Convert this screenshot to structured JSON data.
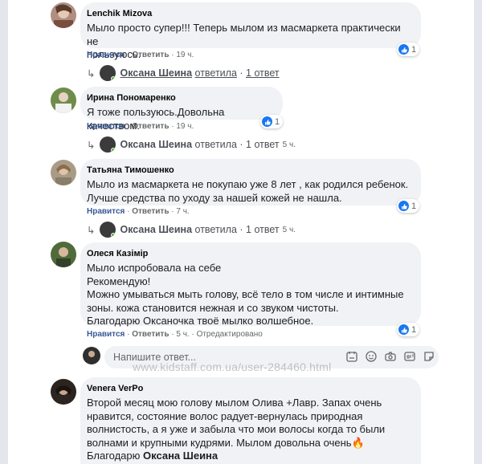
{
  "comments": [
    {
      "author": "Lenchik Mizova",
      "text": "Мыло просто супер!!! Теперь мылом из масмаркета практически не\nпользуюсь.",
      "like": "Нравится",
      "reply": "Ответить",
      "time": "19 ч.",
      "reactions": "1",
      "replies": {
        "author": "Оксана Шеина",
        "verb": "ответила",
        "count": "1 ответ",
        "time": ""
      }
    },
    {
      "author": "Ирина Пономаренко",
      "text": "Я тоже пользуюсь.Довольна качеством.",
      "like": "Нравится",
      "reply": "Ответить",
      "time": "19 ч.",
      "reactions": "1",
      "replies": {
        "author": "Оксана Шеина",
        "verb": "ответила",
        "count": "1 ответ",
        "time": "5 ч."
      }
    },
    {
      "author": "Татьяна Тимошенко",
      "text": "Мыло из масмаркета не покупаю уже 8 лет , как родился ребенок.\nЛучше средства по уходу за нашей кожей не нашла.",
      "like": "Нравится",
      "reply": "Ответить",
      "time": "7 ч.",
      "reactions": "1",
      "replies": {
        "author": "Оксана Шеина",
        "verb": "ответила",
        "count": "1 ответ",
        "time": "5 ч."
      }
    },
    {
      "author": "Олеся Казімір",
      "text": "Мыло испробовала на себе\nРекомендую!\nМожно умываться мыть голову, всё тело в том числе и интимные\nзоны. кожа становится нежная и со звуком чистоты.\nБлагодарю Оксаночка твоё мылко волшебное.",
      "like": "Нравится",
      "reply": "Ответить",
      "time": "5 ч.",
      "edited": "Отредактировано",
      "reactions": "1"
    },
    {
      "author": "Venera VerPo",
      "text": "Второй месяц мою голову мылом Олива +Лавр. Запах очень\nнравится, состояние волос радует-вернулась природная\nволнистость, а я уже и забыла что мои волосы когда то были\nволнами и крупными кудрями. Мылом довольна очень",
      "thanks_prefix": "Благодарю ",
      "thanks_name": "Оксана Шеина"
    }
  ],
  "reply_input": {
    "placeholder": "Напишите ответ..."
  },
  "watermark": "www.kidstaff.com.ua/user-284460.html",
  "colors": {
    "like": "#385898",
    "bubble": "#f0f2f5",
    "meta": "#65676b"
  }
}
